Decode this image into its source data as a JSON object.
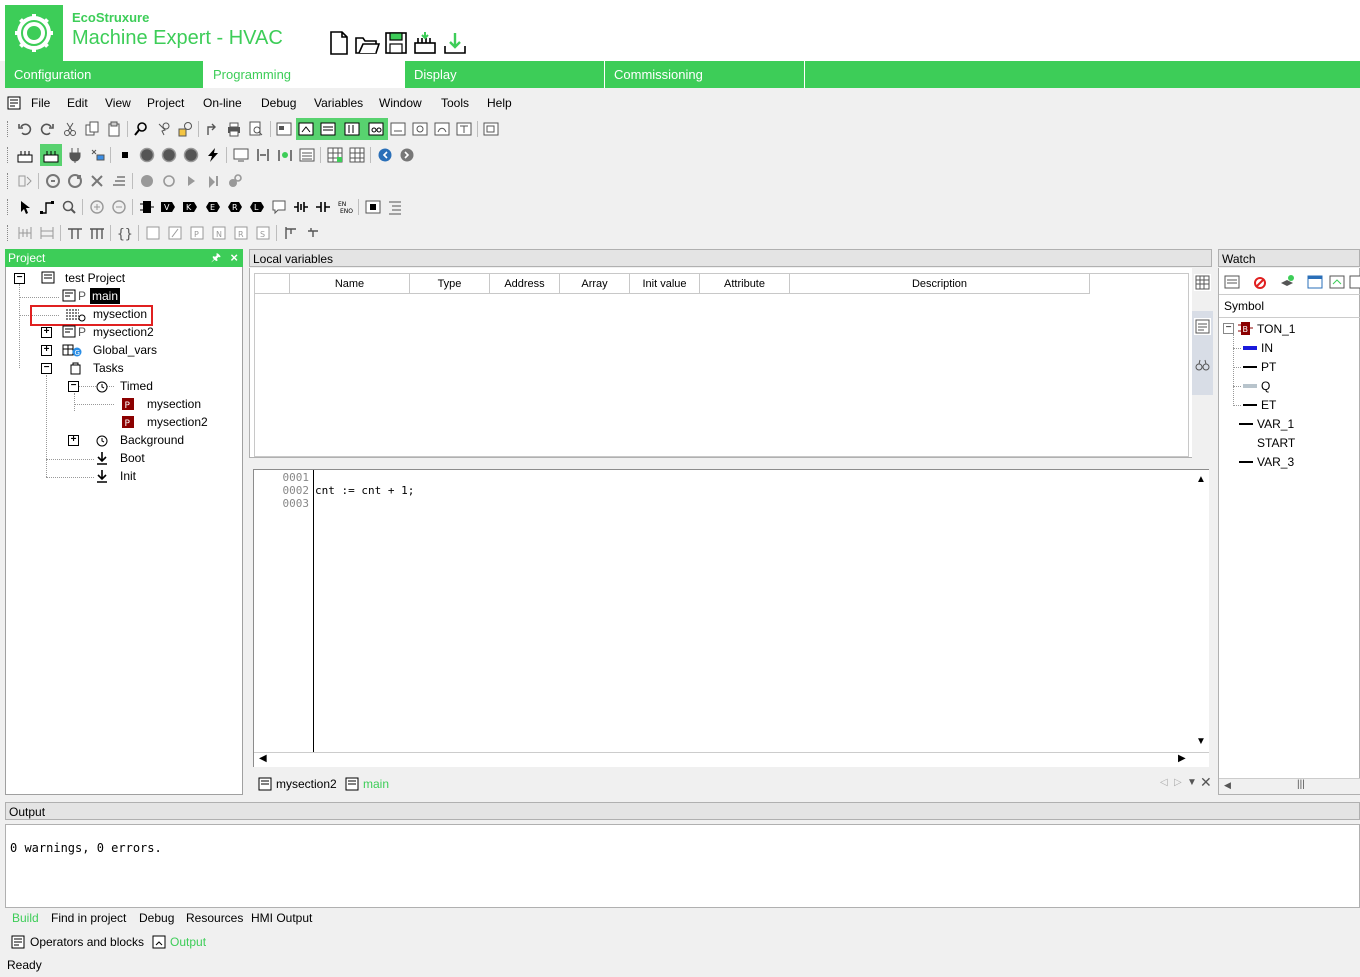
{
  "header": {
    "brand_small": "EcoStruxure",
    "app_title": "Machine Expert - HVAC",
    "colors": {
      "accent": "#3dcd58",
      "highlight_box": "#e02020",
      "selected_bg": "#000000"
    }
  },
  "main_tabs": [
    {
      "label": "Configuration"
    },
    {
      "label": "Programming"
    },
    {
      "label": "Display"
    },
    {
      "label": "Commissioning"
    }
  ],
  "menu": [
    "File",
    "Edit",
    "View",
    "Project",
    "On-line",
    "Debug",
    "Variables",
    "Window",
    "Tools",
    "Help"
  ],
  "project_panel": {
    "title": "Project",
    "tree": {
      "root": "test Project",
      "main": "main",
      "mysection": "mysection",
      "mysection2": "mysection2",
      "global_vars": "Global_vars",
      "tasks": "Tasks",
      "timed": "Timed",
      "timed_mysection": "mysection",
      "timed_mysection2": "mysection2",
      "background": "Background",
      "boot": "Boot",
      "init": "Init",
      "p_badge": "P"
    }
  },
  "local_vars": {
    "title": "Local variables",
    "columns": [
      "Name",
      "Type",
      "Address",
      "Array",
      "Init value",
      "Attribute",
      "Description"
    ]
  },
  "editor": {
    "line_numbers": [
      "0001",
      "0002",
      "0003"
    ],
    "code": "cnt := cnt + 1;",
    "tabs": [
      "mysection2",
      "main"
    ]
  },
  "watch": {
    "title": "Watch",
    "column": "Symbol",
    "items": [
      "TON_1",
      "IN",
      "PT",
      "Q",
      "ET",
      "VAR_1",
      "START",
      "VAR_3"
    ],
    "fb_badge": "B"
  },
  "output": {
    "title": "Output",
    "message": "0 warnings, 0 errors.",
    "tabs": [
      "Build",
      "Find in project",
      "Debug",
      "Resources",
      "HMI Output"
    ]
  },
  "bottom_tabs": [
    "Operators and blocks",
    "Output"
  ],
  "status": "Ready"
}
